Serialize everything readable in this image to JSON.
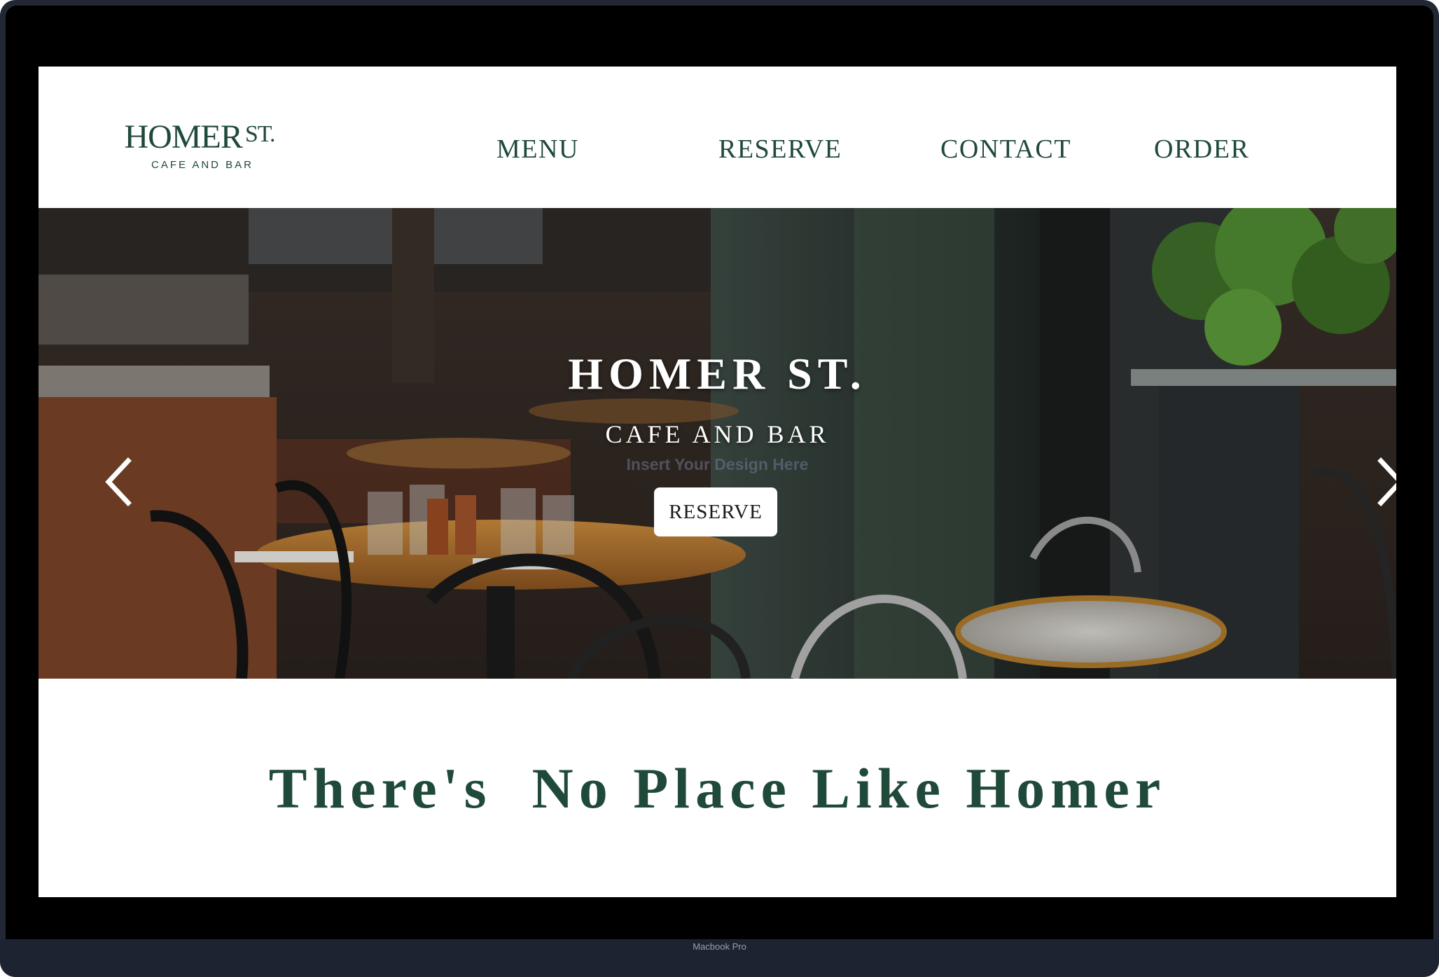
{
  "header": {
    "logo": {
      "main": "HOMER",
      "superscript": "ST.",
      "subtitle": "CAFE AND BAR"
    },
    "nav": [
      {
        "label": "MENU"
      },
      {
        "label": "RESERVE"
      },
      {
        "label": "CONTACT"
      },
      {
        "label": "ORDER"
      }
    ]
  },
  "hero": {
    "title": "HOMER ST.",
    "subtitle": "CAFE AND BAR",
    "placeholder_text": "Insert Your Design Here",
    "button_label": "RESERVE",
    "prev_icon": "chevron-left-icon",
    "next_icon": "chevron-right-icon"
  },
  "tagline": {
    "text": "There's  No Place Like Homer"
  },
  "device": {
    "label": "Macbook Pro"
  },
  "colors": {
    "brand_green": "#1f4a3a",
    "page_bg": "#ffffff",
    "bezel": "#000000",
    "frame": "#222833"
  }
}
